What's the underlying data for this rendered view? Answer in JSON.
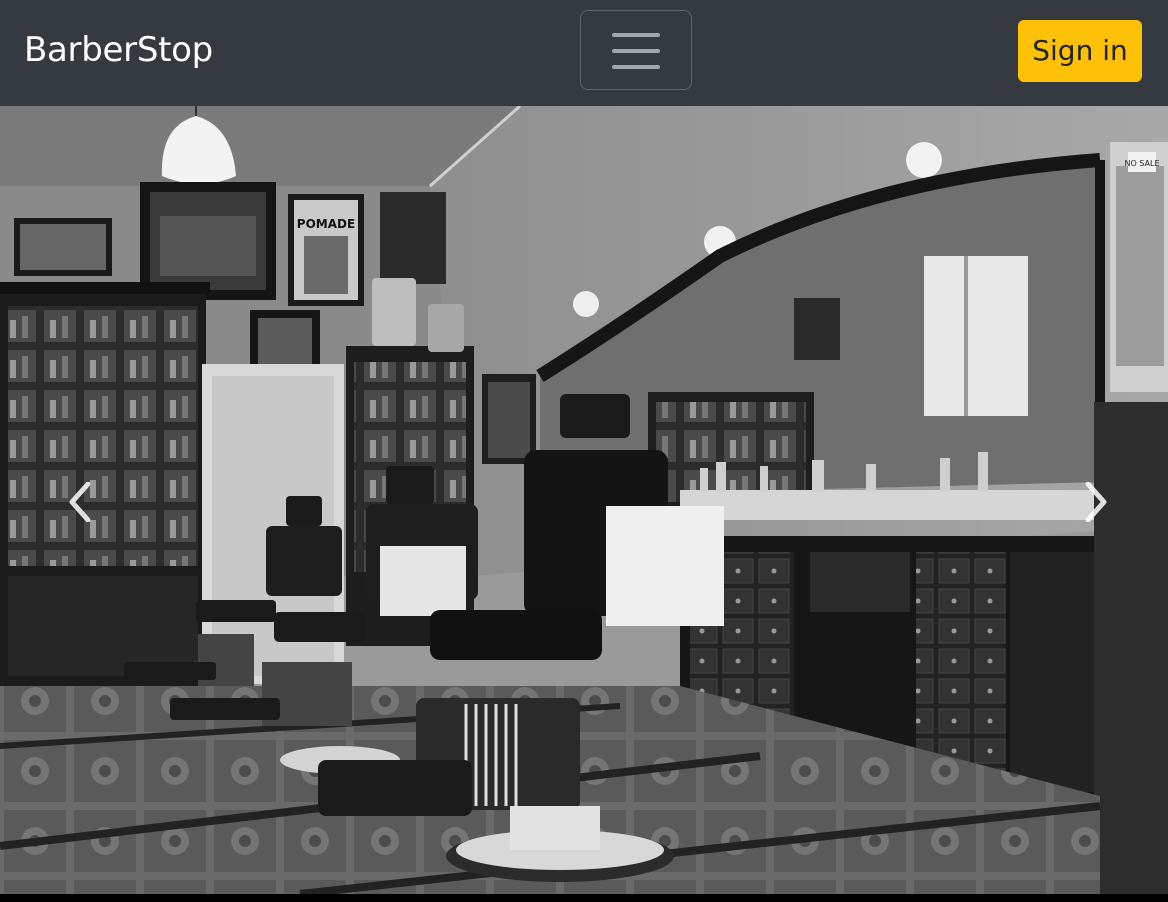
{
  "navbar": {
    "brand": "BarberStop",
    "toggler_icon": "hamburger-menu-icon",
    "signin_label": "Sign in",
    "background_color": "#343a40",
    "signin_color": "#ffc107"
  },
  "hero": {
    "image_description": "Black and white barbershop interior with vintage barber chairs",
    "poster_text": "POMADE",
    "sign_text": "NO SALE",
    "prev_icon": "chevron-left-icon",
    "next_icon": "chevron-right-icon"
  }
}
